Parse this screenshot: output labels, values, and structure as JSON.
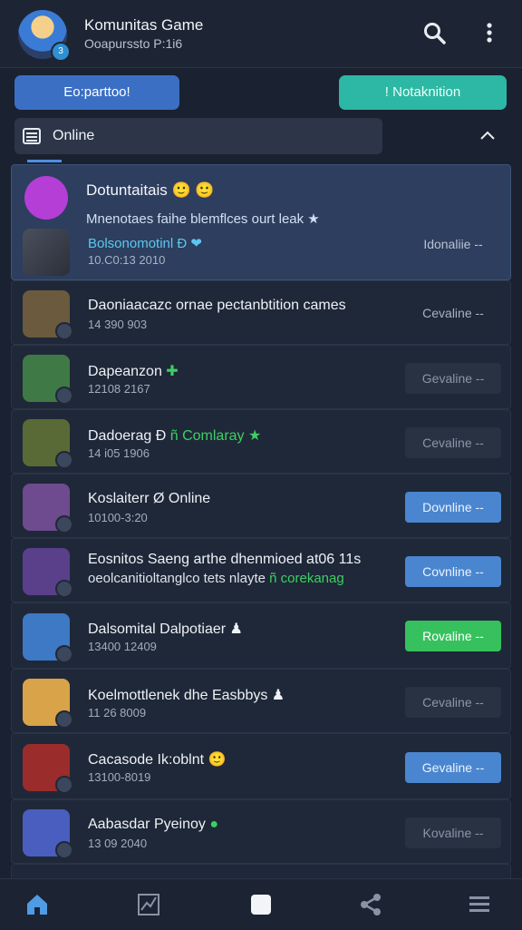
{
  "header": {
    "title": "Komunitas Game",
    "subtitle": "Ooapurssto P:1i6",
    "avatar_badge": "3"
  },
  "actions": {
    "left_button": "Eo:parttoo!",
    "right_button": "! Notaknition"
  },
  "filter": {
    "label": "Online"
  },
  "featured": {
    "title": "Dotuntaitais 🙂 🙂",
    "description": "Mnenotaes faihe blemflces ourt leak ★",
    "player_name": "Bolsonomotinl Ð ❤",
    "time": "10.C0:13 2010",
    "button": "Idonaliie --"
  },
  "rows": [
    {
      "name": "Daoniaacazc ornae pectanbtition cames",
      "time": "14 390 903",
      "button": "Cevaline --",
      "button_style": "plain",
      "thumb_color": "#6b5a3e"
    },
    {
      "name": "Dapeanzon",
      "name_suffix": "✚",
      "time": "12108 2167",
      "button": "Gevaline --",
      "button_style": "dark",
      "thumb_color": "#3f7a46"
    },
    {
      "name": "Dadoerag Ð",
      "name_suffix": "ñ Comlaray ★",
      "time": "14 i05 1906",
      "button": "Cevaline --",
      "button_style": "dark",
      "thumb_color": "#5a6a36"
    },
    {
      "name": "Koslaiterr Ø Online",
      "time": "10100-3:20",
      "button": "Dovnline --",
      "button_style": "blue",
      "thumb_color": "#6e4a8e"
    },
    {
      "name": "Eosnitos Saeng arthe dhenmioed at06 11s",
      "desc2": "oeolcanitioltanglco tets nlayte ",
      "desc2_green": "ñ corekanag",
      "time": "",
      "button": "Covnline --",
      "button_style": "blue",
      "thumb_color": "#5a3f8a"
    },
    {
      "name": "Dalsomital Dalpotiaer ♟",
      "time": "13400 12409",
      "button": "Rovaline --",
      "button_style": "green",
      "thumb_color": "#3d79c4"
    },
    {
      "name": "Koelmottlenek dhe Easbbys ♟",
      "time": "11 26 8009",
      "button": "Cevaline --",
      "button_style": "dark",
      "thumb_color": "#d9a34a"
    },
    {
      "name": "Cacasode Ik:oblnt 🙂",
      "time": "13100-8019",
      "button": "Gevaline --",
      "button_style": "blue",
      "thumb_color": "#9a2c2c"
    },
    {
      "name": "Aabasdar Pyeinoy",
      "name_suffix": "●",
      "time": "13 09 2040",
      "button": "Kovaline --",
      "button_style": "dark",
      "thumb_color": "#4a5ec0"
    }
  ],
  "nav": {
    "items": [
      "home-icon",
      "chart-icon",
      "square-icon",
      "share-icon",
      "menu-icon"
    ]
  },
  "colors": {
    "accent": "#4a86cf",
    "teal": "#2cb8a4",
    "green": "#37c15e",
    "background": "#1a2130"
  }
}
